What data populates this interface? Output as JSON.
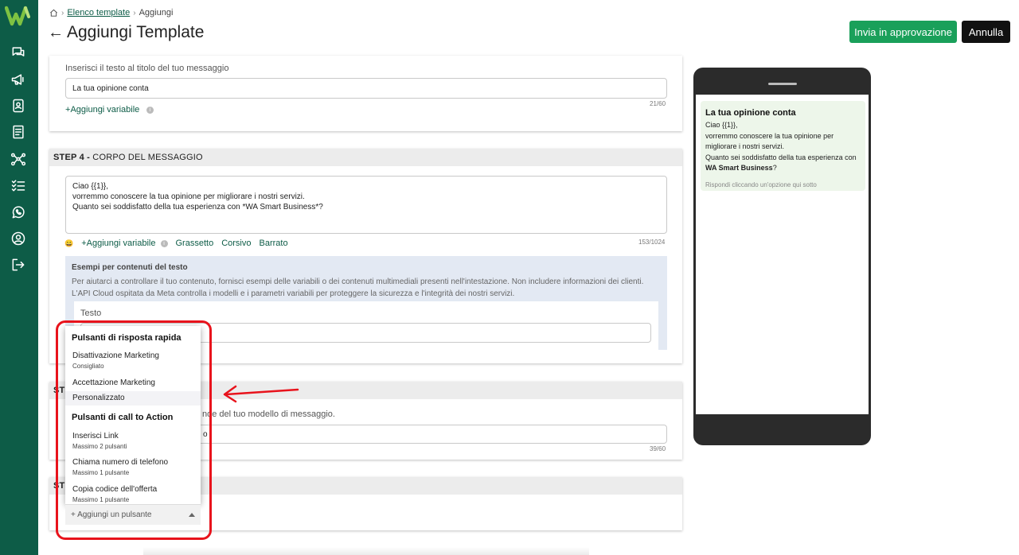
{
  "colors": {
    "brand": "#0d5c47",
    "approve": "#1aa05a",
    "cancel": "#111111",
    "highlight": "#e8131c"
  },
  "sidebar": {
    "logo": "W",
    "icons": [
      "chat-icon",
      "megaphone-icon",
      "contacts-icon",
      "template-icon",
      "flow-icon",
      "tasks-icon",
      "whatsapp-icon",
      "user-icon",
      "logout-icon"
    ]
  },
  "breadcrumb": {
    "home_icon": "home-icon",
    "link": "Elenco template",
    "current": "Aggiungi"
  },
  "header": {
    "title": "Aggiungi Template",
    "approve_label": "Invia in approvazione",
    "cancel_label": "Annulla"
  },
  "step3": {
    "hint": "Inserisci il testo al titolo del tuo messaggio",
    "value": "La tua opinione conta",
    "add_variable": "Aggiungi variabile",
    "counter": "21/60"
  },
  "step4": {
    "head_bold": "STEP 4 -",
    "head_rest": "CORPO DEL MESSAGGIO",
    "body_lines": [
      "Ciao {{1}},",
      "vorremmo conoscere la tua opinione per migliorare i nostri servizi.",
      "Quanto sei soddisfatto della tua esperienza con *WA Smart Business*?"
    ],
    "emoji": "😀",
    "add_variable": "Aggiungi variabile",
    "bold": "Grassetto",
    "italic": "Corsivo",
    "strike": "Barrato",
    "counter": "153/1024",
    "examples_title": "Esempi per contenuti del testo",
    "examples_desc": "Per aiutarci a controllare il tuo contenuto, fornisci esempi delle variabili o dei contenuti multimediali presenti nell'intestazione. Non includere informazioni dei clienti. L'API Cloud ospitata da Meta controlla i modelli e i parametri variabili per proteggere la sicurezza e l'integrità dei nostri servizi.",
    "examples_field_label": "Testo"
  },
  "step5": {
    "head_partial": "ST",
    "hint_partial": "nde del tuo modello di messaggio.",
    "value_partial": "o",
    "counter": "39/60"
  },
  "step6": {
    "head_partial": "ST"
  },
  "dropdown": {
    "group1": "Pulsanti di risposta rapida",
    "items1": [
      {
        "name": "Disattivazione Marketing",
        "sub": "Consigliato"
      },
      {
        "name": "Accettazione Marketing",
        "sub": ""
      },
      {
        "name": "Personalizzato",
        "sub": ""
      }
    ],
    "group2": "Pulsanti di call to Action",
    "items2": [
      {
        "name": "Inserisci Link",
        "sub": "Massimo 2 pulsanti"
      },
      {
        "name": "Chiama numero di telefono",
        "sub": "Massimo 1 pulsante"
      },
      {
        "name": "Copia codice dell'offerta",
        "sub": "Massimo 1 pulsante"
      }
    ],
    "select_label": "+ Aggiungi un pulsante"
  },
  "preview": {
    "title": "La tua opinione conta",
    "line1": "Ciao {{1}},",
    "line2": "vorremmo conoscere la tua opinione per",
    "line3": "migliorare i nostri servizi.",
    "line4": "Quanto sei soddisfatto della tua esperienza con",
    "line5": "WA Smart Business",
    "line5_end": "?",
    "footer": "Rispondi cliccando un'opzione qui sotto"
  }
}
